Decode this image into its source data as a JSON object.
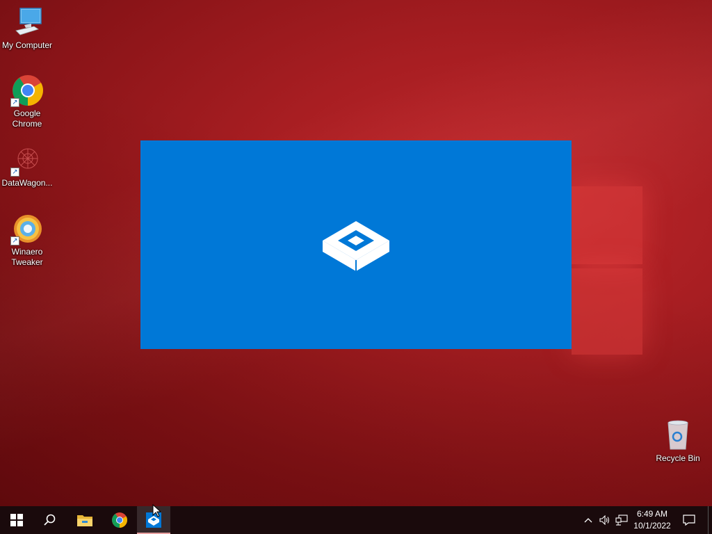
{
  "desktop": {
    "icons": [
      {
        "label": "My Computer",
        "icon": "computer-icon"
      },
      {
        "label": "Google Chrome",
        "icon": "chrome-icon"
      },
      {
        "label": "DataWagon...",
        "icon": "datawagon-icon"
      },
      {
        "label": "Winaero Tweaker",
        "icon": "winaero-tweaker-icon"
      },
      {
        "label": "Recycle Bin",
        "icon": "recycle-bin-icon"
      }
    ]
  },
  "splash": {
    "icon": "sandbox-box-icon",
    "color": "#0078d7"
  },
  "taskbar": {
    "items": [
      {
        "icon": "windows-start-icon"
      },
      {
        "icon": "search-icon"
      },
      {
        "icon": "file-explorer-icon"
      },
      {
        "icon": "chrome-icon"
      },
      {
        "icon": "sandbox-icon",
        "active": true
      }
    ],
    "tray": [
      "chevron-up-icon",
      "volume-icon",
      "network-icon"
    ],
    "clock": {
      "time": "6:49 AM",
      "date": "10/1/2022"
    },
    "notifications_icon": "action-center-icon"
  }
}
